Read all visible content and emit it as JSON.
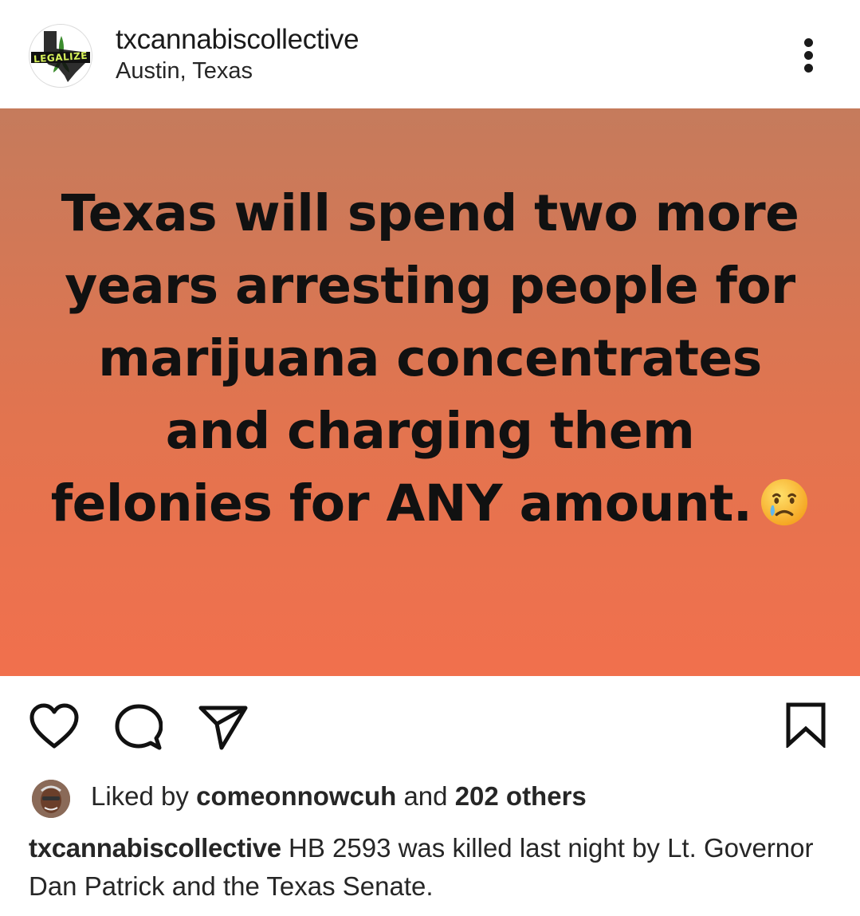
{
  "header": {
    "username": "txcannabiscollective",
    "location": "Austin, Texas",
    "avatar_text": "LEGALIZE"
  },
  "post": {
    "text": "Texas will spend two more years arresting people for marijuana concentrates and charging them felonies for ANY amount.",
    "emoji": "crying-face-emoji",
    "background_colors": [
      "#c57b5c",
      "#f1704d"
    ]
  },
  "actions": {
    "icons": [
      "heart-icon",
      "comment-icon",
      "share-icon",
      "bookmark-icon"
    ]
  },
  "likes": {
    "prefix": "Liked by",
    "user": "comeonnowcuh",
    "middle": "and",
    "others": "202 others"
  },
  "caption": {
    "username": "txcannabiscollective",
    "text": "HB 2593 was killed last night by Lt. Governor Dan Patrick and the Texas Senate."
  }
}
